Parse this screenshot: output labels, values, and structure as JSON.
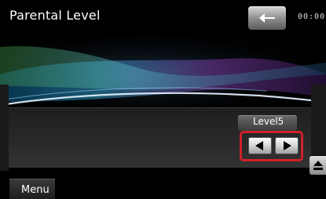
{
  "header": {
    "title": "Parental Level",
    "clock": "00:00",
    "back_icon": "back-arrow-icon"
  },
  "level": {
    "value": "Level5"
  },
  "controls": {
    "prev_icon": "triangle-left-icon",
    "next_icon": "triangle-right-icon",
    "highlight_color": "#d0222a"
  },
  "side": {
    "icon": "eject-icon"
  },
  "footer": {
    "menu_label": "Menu"
  }
}
